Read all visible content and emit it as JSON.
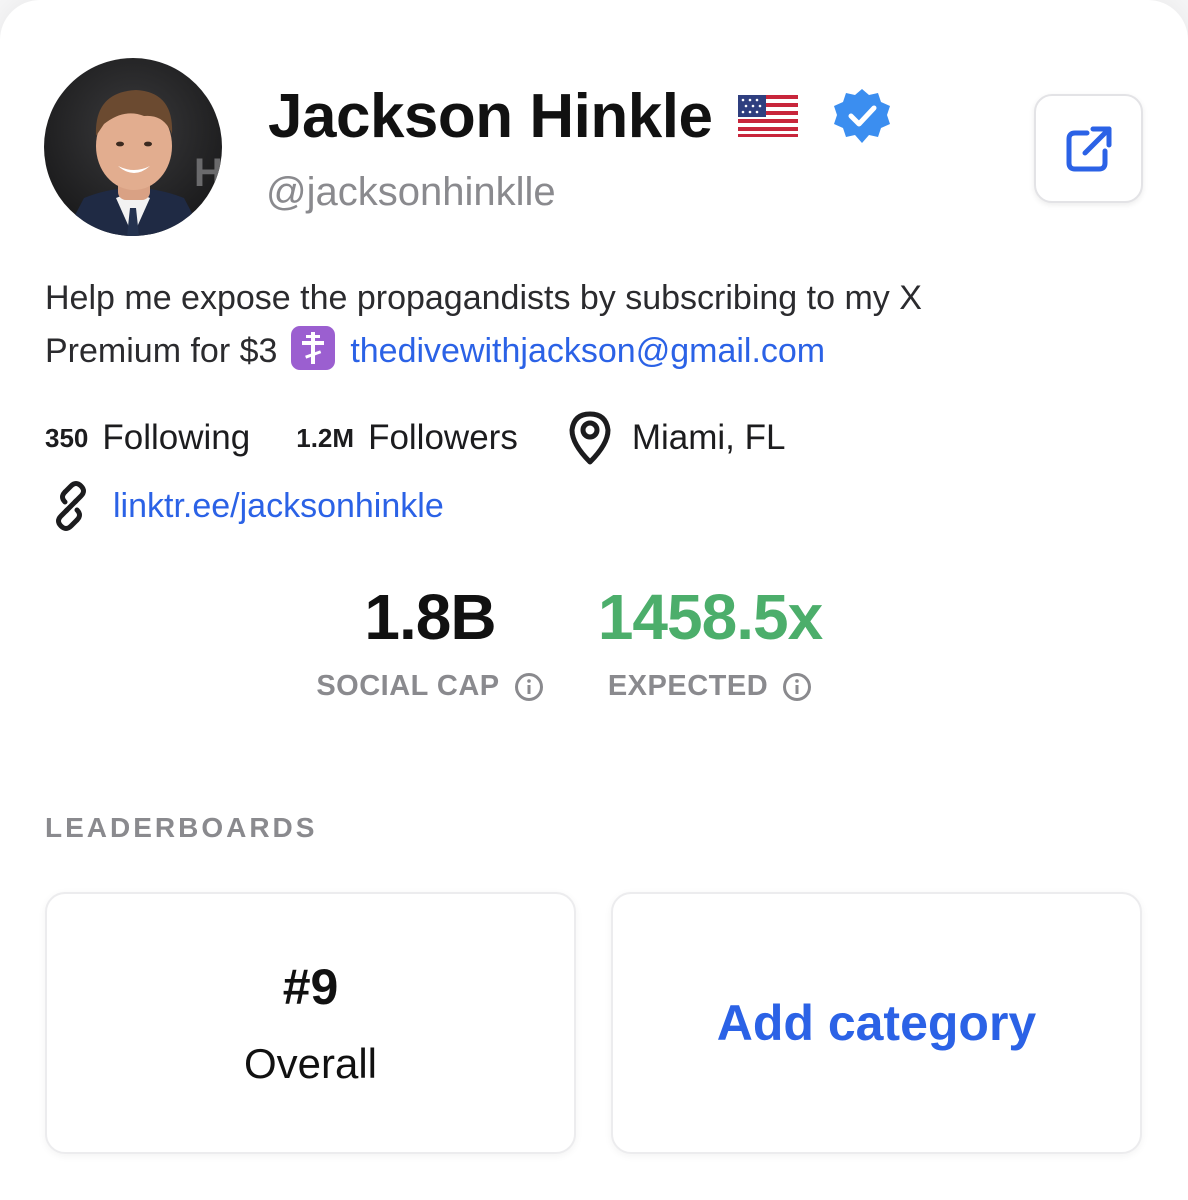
{
  "profile": {
    "display_name": "Jackson Hinkle",
    "flag_icon": "us-flag-icon",
    "verified_icon": "verified-badge-icon",
    "handle": "@jacksonhinklle",
    "share_icon": "external-link-icon"
  },
  "bio": {
    "text_part1": "Help me expose the propagandists by subscribing to my X Premium for $3",
    "emoji_icon": "orthodox-cross-icon",
    "email": "thedivewithjackson@gmail.com"
  },
  "stats": {
    "following_count": "350",
    "following_label": "Following",
    "followers_count": "1.2M",
    "followers_label": "Followers",
    "location": "Miami, FL",
    "website": "linktr.ee/jacksonhinkle"
  },
  "metrics": {
    "social_cap_value": "1.8B",
    "social_cap_label": "SOCIAL CAP",
    "expected_value": "1458.5x",
    "expected_label": "EXPECTED"
  },
  "leaderboards": {
    "title": "LEADERBOARDS",
    "rank": "#9",
    "rank_label": "Overall",
    "add_label": "Add category"
  },
  "colors": {
    "accent": "#2b62e6",
    "positive": "#4cae6b",
    "verified": "#3b8ef0",
    "muted": "#8a8a8e"
  }
}
